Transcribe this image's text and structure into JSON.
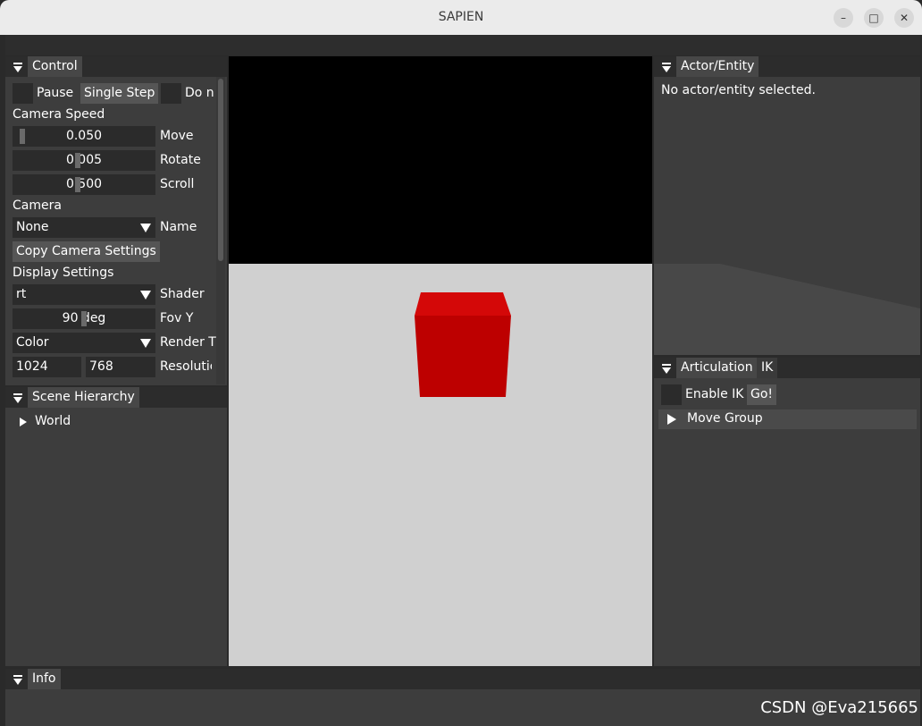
{
  "window": {
    "title": "SAPIEN",
    "minimize_symbol": "–",
    "maximize_symbol": "□",
    "close_symbol": "✕"
  },
  "control": {
    "tab_label": "Control",
    "pause_label": "Pause",
    "single_step_label": "Single Step",
    "do_label": "Do n",
    "camera_speed_title": "Camera Speed",
    "sliders": [
      {
        "value_text": "0.050",
        "label": "Move"
      },
      {
        "value_text": "0.005",
        "label": "Rotate"
      },
      {
        "value_text": "0.500",
        "label": "Scroll"
      }
    ],
    "camera_title": "Camera",
    "camera_combo_value": "None",
    "camera_name_label": "Name",
    "copy_camera_settings_label": "Copy Camera Settings",
    "display_settings_title": "Display Settings",
    "shader_combo_value": "rt",
    "shader_label": "Shader",
    "fov_value_text": "90 deg",
    "fov_label": "Fov Y",
    "render_combo_value": "Color",
    "render_label": "Render T",
    "resolution_width": "1024",
    "resolution_height": "768",
    "resolution_label": "Resolutic"
  },
  "scene_hierarchy": {
    "tab_label": "Scene Hierarchy",
    "root_item": "World"
  },
  "actor_entity": {
    "tab_label": "Actor/Entity",
    "empty_message": "No actor/entity selected."
  },
  "articulation": {
    "tab_label": "Articulation",
    "ik_tab_label": "IK",
    "enable_ik_label": "Enable IK",
    "go_label": "Go!",
    "move_group_label": "Move Group"
  },
  "info": {
    "tab_label": "Info"
  },
  "viewport": {
    "sky_color": "#000000",
    "floor_color": "#d0d0d0",
    "cube_front_color": "#bd0000",
    "cube_top_color": "#d40808"
  },
  "watermark": "CSDN @Eva215665"
}
